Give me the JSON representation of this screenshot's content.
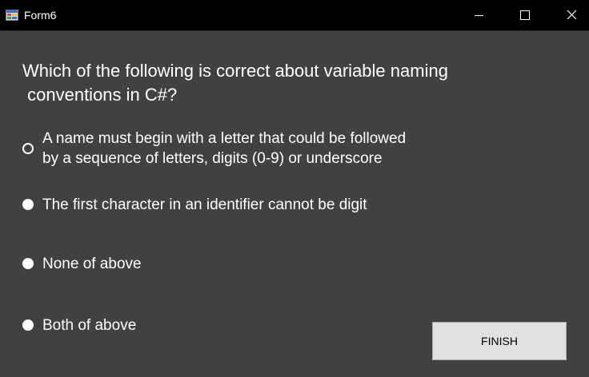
{
  "window": {
    "title": "Form6",
    "icon": "winforms-app-icon",
    "controls": {
      "minimize_icon": "minimize-icon",
      "maximize_icon": "maximize-icon",
      "close_icon": "close-icon"
    }
  },
  "quiz": {
    "question": "Which of the following is correct about variable naming\n conventions in C#?",
    "options": [
      {
        "label": "A name must begin with a letter that could be followed\nby a sequence of letters, digits (0-9) or underscore",
        "selected": false
      },
      {
        "label": "The first character in an identifier cannot be digit",
        "selected": false
      },
      {
        "label": "None of above",
        "selected": false
      },
      {
        "label": "Both of above",
        "selected": false
      }
    ],
    "finish_label": "FINISH"
  },
  "colors": {
    "titlebar": "#000000",
    "background": "#414141",
    "text": "#ffffff",
    "button_bg": "#e1e1e1",
    "button_border": "#adadad"
  }
}
